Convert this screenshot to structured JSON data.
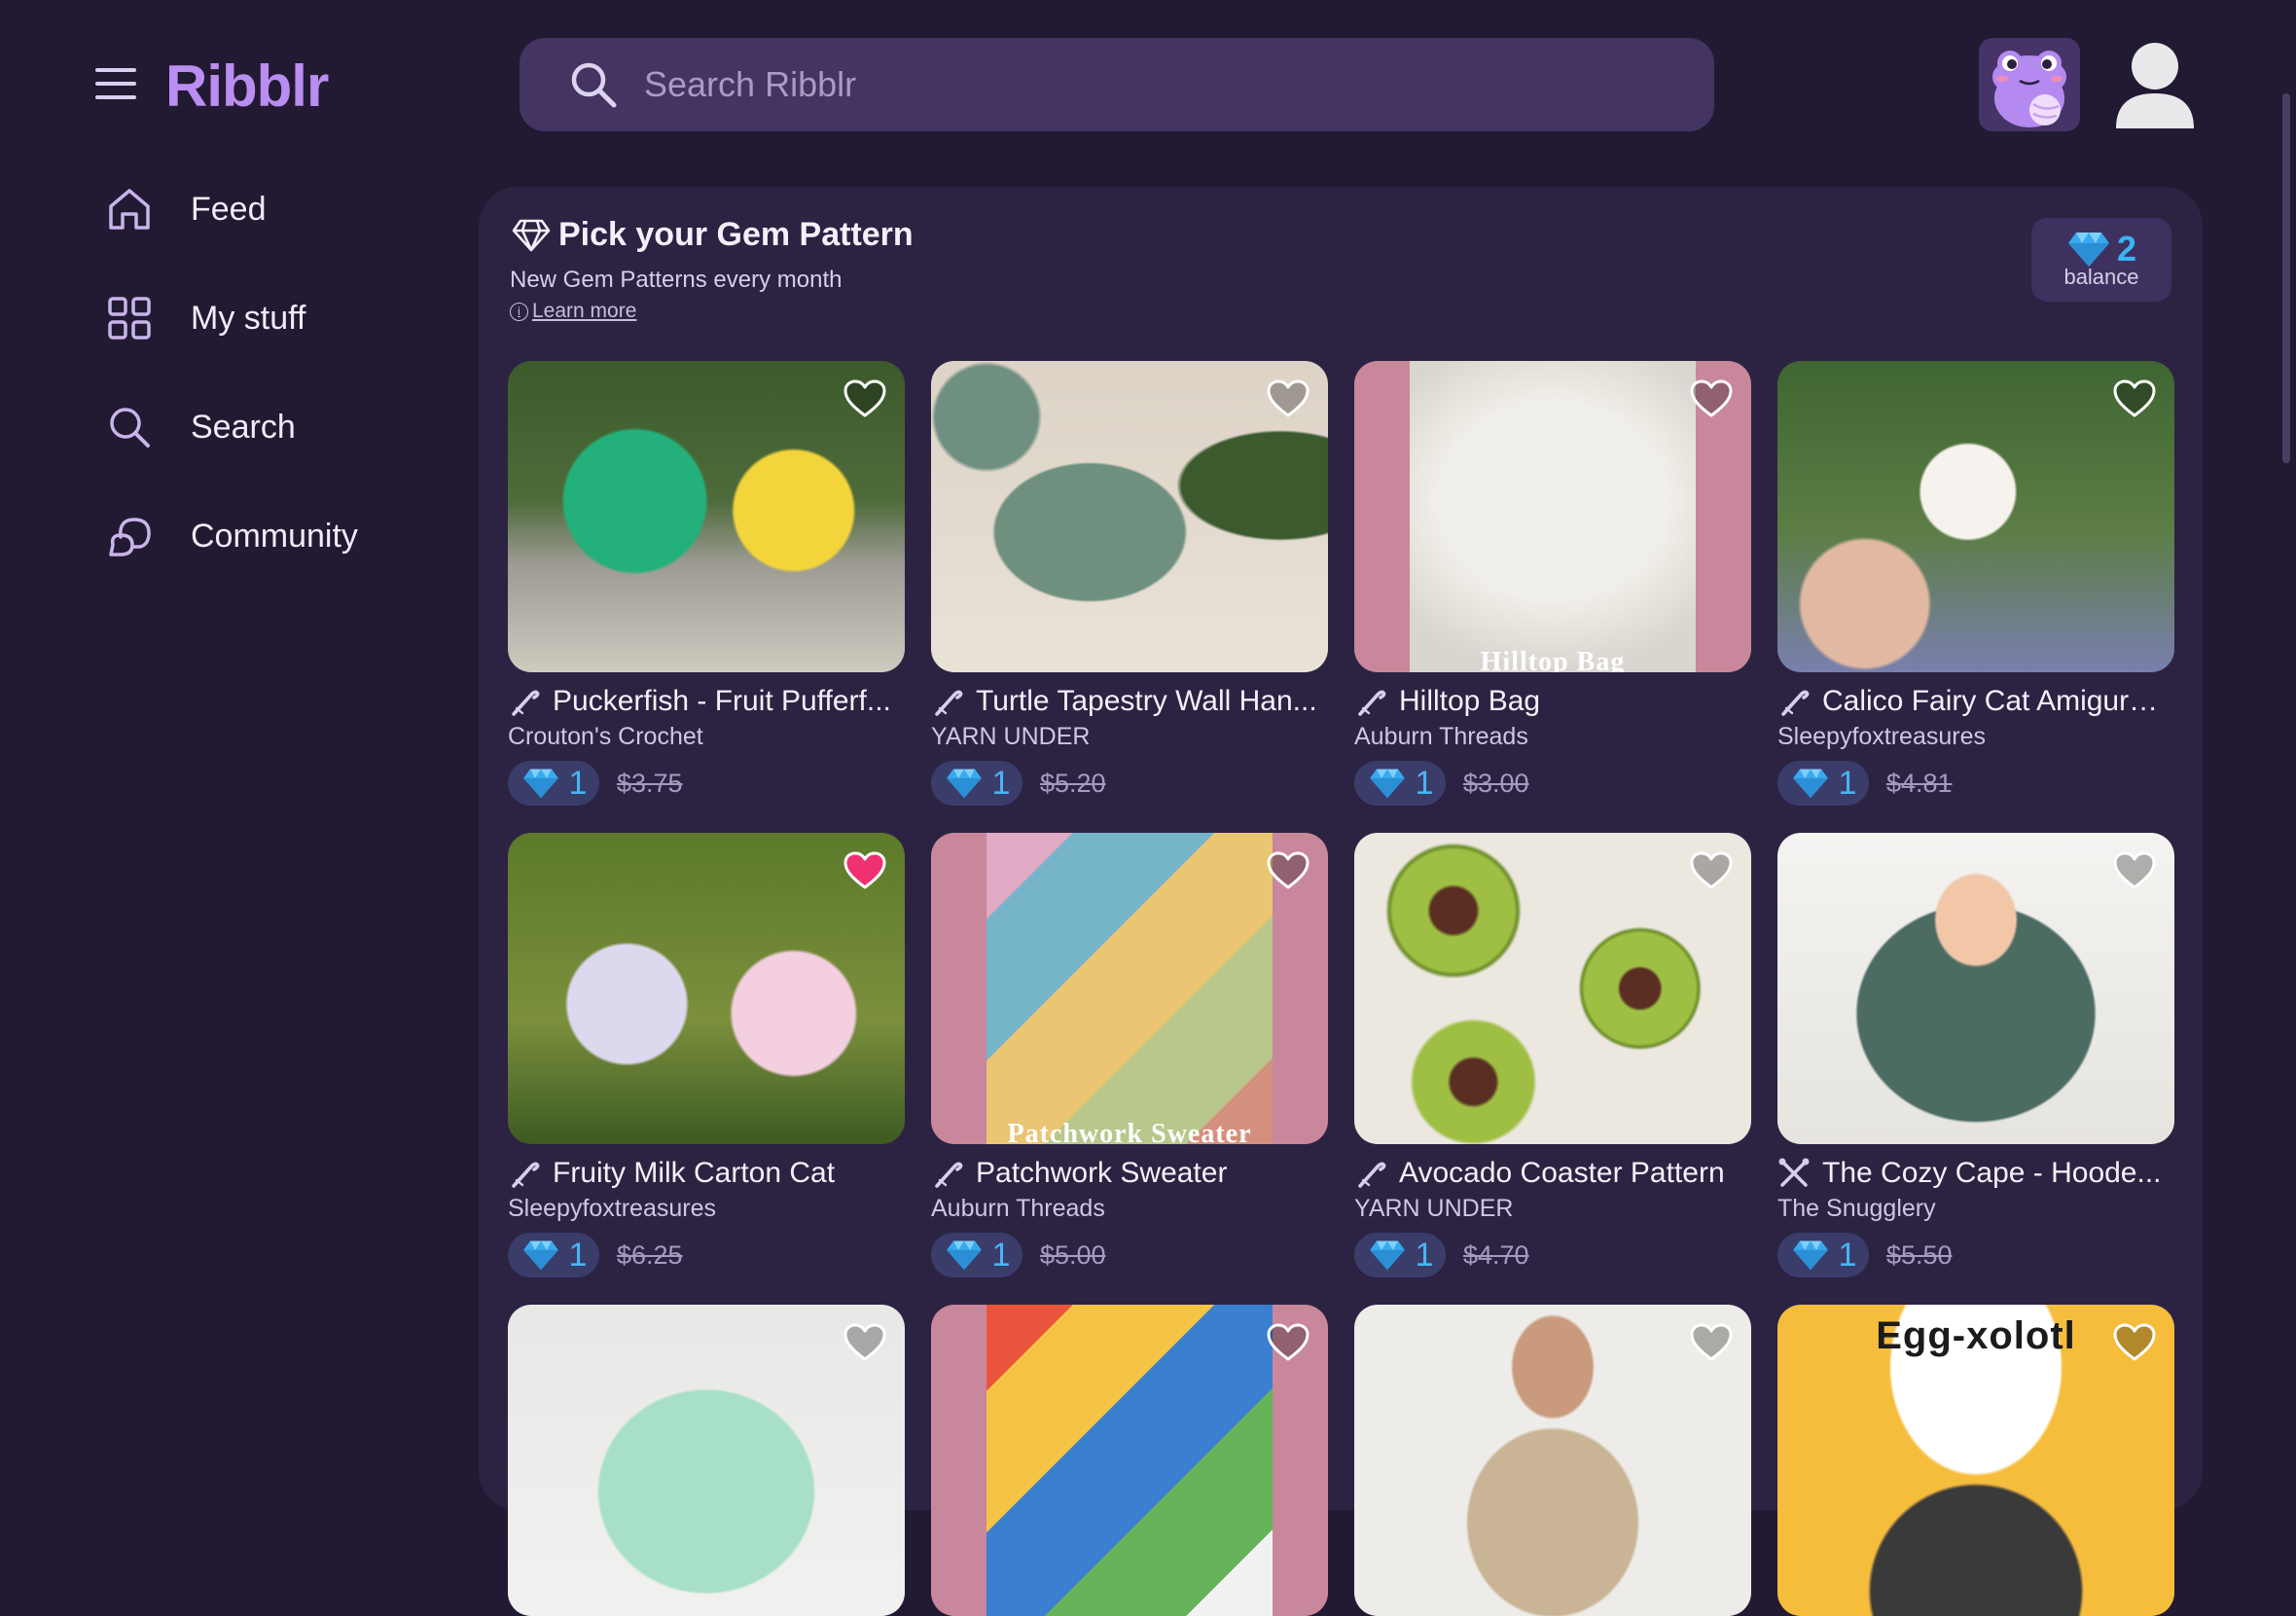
{
  "app": {
    "name": "Ribblr"
  },
  "search": {
    "placeholder": "Search Ribblr"
  },
  "sidebar": {
    "items": [
      {
        "label": "Feed",
        "icon": "home-icon"
      },
      {
        "label": "My stuff",
        "icon": "grid-icon"
      },
      {
        "label": "Search",
        "icon": "search-icon"
      },
      {
        "label": "Community",
        "icon": "chat-bubbles-icon"
      }
    ]
  },
  "gem_section": {
    "title": "Pick your Gem Pattern",
    "subtitle": "New Gem Patterns every month",
    "learn_more": "Learn more",
    "balance_value": "2",
    "balance_label": "balance"
  },
  "colors": {
    "accent": "#b98ef0",
    "gem": "#3ab4f2",
    "liked": "#f0316f",
    "background": "#221a33",
    "panel": "#2c2342"
  },
  "cards": [
    {
      "title": "Puckerfish - Fruit Pufferf...",
      "designer": "Crouton's Crochet",
      "gems": "1",
      "price": "$3.75",
      "liked": false,
      "craft": "crochet-hook-icon",
      "image_text": ""
    },
    {
      "title": "Turtle Tapestry Wall Han...",
      "designer": "YARN UNDER",
      "gems": "1",
      "price": "$5.20",
      "liked": false,
      "craft": "crochet-hook-icon",
      "image_text": ""
    },
    {
      "title": "Hilltop Bag",
      "designer": "Auburn Threads",
      "gems": "1",
      "price": "$3.00",
      "liked": false,
      "craft": "crochet-hook-icon",
      "image_text": "Hilltop Bag"
    },
    {
      "title": "Calico Fairy Cat Amiguru...",
      "designer": "Sleepyfoxtreasures",
      "gems": "1",
      "price": "$4.81",
      "liked": false,
      "craft": "crochet-hook-icon",
      "image_text": ""
    },
    {
      "title": "Fruity Milk Carton Cat",
      "designer": "Sleepyfoxtreasures",
      "gems": "1",
      "price": "$6.25",
      "liked": true,
      "craft": "crochet-hook-icon",
      "image_text": ""
    },
    {
      "title": "Patchwork Sweater",
      "designer": "Auburn Threads",
      "gems": "1",
      "price": "$5.00",
      "liked": false,
      "craft": "crochet-hook-icon",
      "image_text": "Patchwork Sweater"
    },
    {
      "title": "Avocado Coaster Pattern",
      "designer": "YARN UNDER",
      "gems": "1",
      "price": "$4.70",
      "liked": false,
      "craft": "crochet-hook-icon",
      "image_text": ""
    },
    {
      "title": "The Cozy Cape - Hoode...",
      "designer": "The Snugglery",
      "gems": "1",
      "price": "$5.50",
      "liked": false,
      "craft": "knitting-needles-icon",
      "image_text": ""
    },
    {
      "title": "",
      "designer": "",
      "gems": "",
      "price": "",
      "liked": false,
      "craft": "",
      "image_text": ""
    },
    {
      "title": "",
      "designer": "",
      "gems": "",
      "price": "",
      "liked": false,
      "craft": "",
      "image_text": ""
    },
    {
      "title": "",
      "designer": "",
      "gems": "",
      "price": "",
      "liked": false,
      "craft": "",
      "image_text": ""
    },
    {
      "title": "",
      "designer": "",
      "gems": "",
      "price": "",
      "liked": false,
      "craft": "",
      "image_text": "Egg-xolotl"
    }
  ]
}
